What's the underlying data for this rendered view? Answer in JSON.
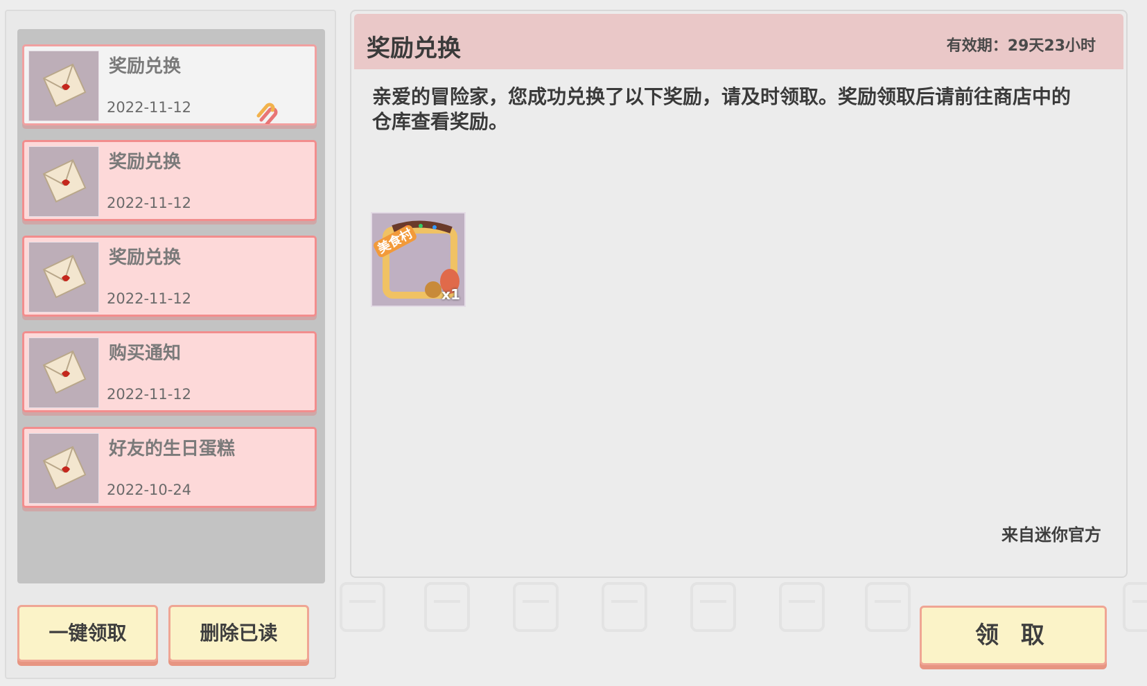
{
  "mail_list": {
    "items": [
      {
        "title": "奖励兑换",
        "date": "2022-11-12",
        "selected": true,
        "has_attachment": true,
        "icon": "letter-icon"
      },
      {
        "title": "奖励兑换",
        "date": "2022-11-12",
        "selected": false,
        "has_attachment": false,
        "icon": "letter-icon"
      },
      {
        "title": "奖励兑换",
        "date": "2022-11-12",
        "selected": false,
        "has_attachment": false,
        "icon": "letter-icon"
      },
      {
        "title": "购买通知",
        "date": "2022-11-12",
        "selected": false,
        "has_attachment": false,
        "icon": "letter-icon"
      },
      {
        "title": "好友的生日蛋糕",
        "date": "2022-10-24",
        "selected": false,
        "has_attachment": false,
        "icon": "letter-icon"
      }
    ]
  },
  "buttons": {
    "claim_all": "一键领取",
    "delete_read": "删除已读",
    "claim": "领 取"
  },
  "detail": {
    "title": "奖励兑换",
    "expiry": "有效期：29天23小时",
    "body": "亲爱的冒险家，您成功兑换了以下奖励，请及时领取。奖励领取后请前往商店中的仓库查看奖励。",
    "sender": "来自迷你官方",
    "reward": {
      "label": "美食村",
      "quantity": "x1",
      "icon": "avatar-frame-icon"
    }
  },
  "colors": {
    "item_bg": "#fdd9d9",
    "item_border": "#f28d8d",
    "header_bg": "#eac8c8",
    "button_bg": "#fbf3c8"
  }
}
